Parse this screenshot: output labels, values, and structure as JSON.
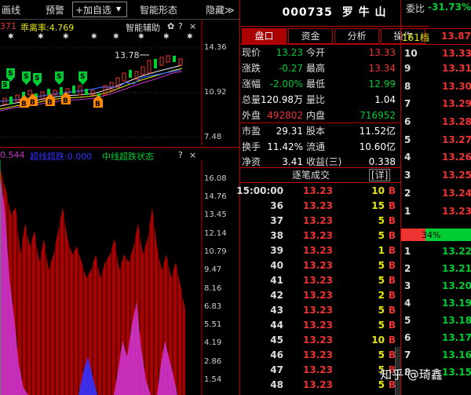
{
  "toolbar": {
    "items": [
      "画线",
      "预警",
      "+加自选",
      "智能形态",
      "隐藏≫"
    ],
    "dropdown_glyph": "▾"
  },
  "top_chart": {
    "indicator_left": "371",
    "indicator_name": "乖离率:4.769",
    "indicator_right": "智能辅助",
    "gear_glyph": "✿",
    "help_glyph": "?",
    "close_glyph": "×",
    "price_marker": "13.78",
    "axis_ticks": [
      "14.36",
      "10.92",
      "7.48"
    ],
    "signal_labels_s": [
      "S",
      "S",
      "S",
      "S",
      "S",
      "S"
    ],
    "signal_labels_b": [
      "B",
      "B",
      "B",
      "B",
      "B"
    ]
  },
  "bottom_chart": {
    "value_left": "0.544",
    "ultra_short": "超线超跌:0.000",
    "mid_line": "中线超跌状态",
    "help_glyph": "?",
    "close_glyph": "×",
    "axis_ticks": [
      "16.08",
      "14.76",
      "13.45",
      "12.14",
      "10.79",
      "9.47",
      "8.16",
      "6.83",
      "5.51",
      "4.19",
      "2.86",
      "1.54"
    ]
  },
  "stock": {
    "code": "000735",
    "name": "罗 牛 山"
  },
  "tabs": [
    "盘口",
    "资金",
    "分析",
    "操作"
  ],
  "quote": [
    {
      "l1": "现价",
      "v1": "13.23",
      "l2": "今开",
      "v2": "13.33"
    },
    {
      "l1": "涨跌",
      "v1": "-0.27",
      "l2": "最高",
      "v2": "13.34"
    },
    {
      "l1": "涨幅",
      "v1": "-2.00%",
      "l2": "最低",
      "v2": "12.99"
    },
    {
      "l1": "总量",
      "v1": "120.98万",
      "l2": "量比",
      "v2": "1.04"
    },
    {
      "l1": "外盘",
      "v1": "492802",
      "l2": "内盘",
      "v2": "716952"
    },
    {
      "l1": "市盈",
      "v1": "29.31",
      "l2": "股本",
      "v2": "11.52亿"
    },
    {
      "l1": "换手",
      "v1": "11.42%",
      "l2": "流通",
      "v2": "10.60亿"
    },
    {
      "l1": "净资",
      "v1": "3.41",
      "l2": "收益(三)",
      "v2": "0.338"
    }
  ],
  "tick_header": {
    "title": "逐笔成交",
    "detail": "[详]"
  },
  "ticks": [
    {
      "t": "15:00:00",
      "p": "13.23",
      "q": "10",
      "s": "B"
    },
    {
      "t": "36",
      "p": "13.23",
      "q": "15",
      "s": "B"
    },
    {
      "t": "37",
      "p": "13.23",
      "q": "5",
      "s": "B"
    },
    {
      "t": "38",
      "p": "13.23",
      "q": "5",
      "s": "B"
    },
    {
      "t": "39",
      "p": "13.23",
      "q": "1",
      "s": "B"
    },
    {
      "t": "40",
      "p": "13.23",
      "q": "5",
      "s": "B"
    },
    {
      "t": "41",
      "p": "13.23",
      "q": "5",
      "s": "B"
    },
    {
      "t": "42",
      "p": "13.23",
      "q": "2",
      "s": "B"
    },
    {
      "t": "43",
      "p": "13.23",
      "q": "5",
      "s": "B"
    },
    {
      "t": "44",
      "p": "13.23",
      "q": "5",
      "s": "B"
    },
    {
      "t": "45",
      "p": "13.23",
      "q": "10",
      "s": "B"
    },
    {
      "t": "46",
      "p": "13.23",
      "q": "5",
      "s": "B"
    },
    {
      "t": "47",
      "p": "13.23",
      "q": "5",
      "s": "B"
    },
    {
      "t": "48",
      "p": "13.23",
      "q": "5",
      "s": "B"
    }
  ],
  "depth": {
    "wei_label": "委比",
    "wei_value": "-31.73%",
    "level_label": "161档",
    "level_price": "13.87",
    "sell": [
      {
        "lv": "10",
        "p": "13.33"
      },
      {
        "lv": "9",
        "p": "13.31"
      },
      {
        "lv": "8",
        "p": "13.30"
      },
      {
        "lv": "7",
        "p": "13.29"
      },
      {
        "lv": "6",
        "p": "13.28"
      },
      {
        "lv": "5",
        "p": "13.27"
      },
      {
        "lv": "4",
        "p": "13.26"
      },
      {
        "lv": "3",
        "p": "13.25"
      },
      {
        "lv": "2",
        "p": "13.24"
      },
      {
        "lv": "1",
        "p": "13.23"
      }
    ],
    "ratio_label": "34%",
    "ratio_fraction": 0.34,
    "buy": [
      {
        "lv": "1",
        "p": "13.22"
      },
      {
        "lv": "2",
        "p": "13.21"
      },
      {
        "lv": "3",
        "p": "13.20"
      },
      {
        "lv": "4",
        "p": "13.19"
      },
      {
        "lv": "5",
        "p": "13.18"
      },
      {
        "lv": "6",
        "p": "13.17"
      },
      {
        "lv": "7",
        "p": "13.16"
      },
      {
        "lv": "8",
        "p": "13.15"
      }
    ]
  },
  "watermark": "知乎 @琦鑫",
  "colors": {
    "up": "#e33333",
    "down": "#00cc33",
    "label_yellow": "#e8e800",
    "accent_red": "#aa0000"
  }
}
